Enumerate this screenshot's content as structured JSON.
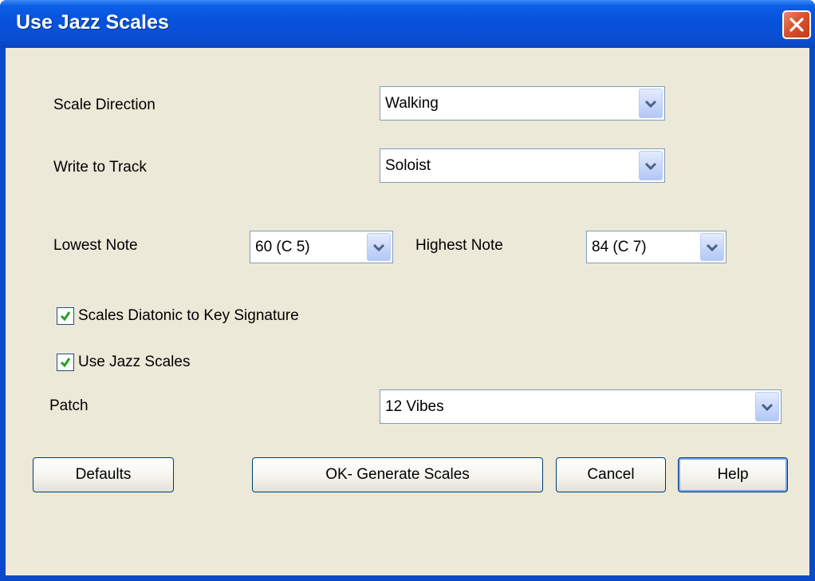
{
  "window": {
    "title": "Use Jazz Scales",
    "close_icon": "close-icon"
  },
  "form": {
    "scale_direction": {
      "label": "Scale Direction",
      "value": "Walking"
    },
    "write_to_track": {
      "label": "Write to Track",
      "value": "Soloist"
    },
    "lowest_note": {
      "label": "Lowest Note",
      "value": "60  (C 5)"
    },
    "highest_note": {
      "label": "Highest Note",
      "value": "84  (C 7)"
    },
    "scales_diatonic": {
      "label": "Scales Diatonic to Key Signature",
      "checked": true
    },
    "use_jazz_scales": {
      "label": "Use Jazz Scales",
      "checked": true
    },
    "patch": {
      "label": "Patch",
      "value": "12 Vibes"
    }
  },
  "buttons": {
    "defaults": "Defaults",
    "ok": "OK- Generate Scales",
    "cancel": "Cancel",
    "help": "Help"
  },
  "colors": {
    "titlebar": "#0752db",
    "close_button": "#d9532e",
    "dialog_bg": "#ece9d8",
    "check_mark": "#21a121"
  }
}
